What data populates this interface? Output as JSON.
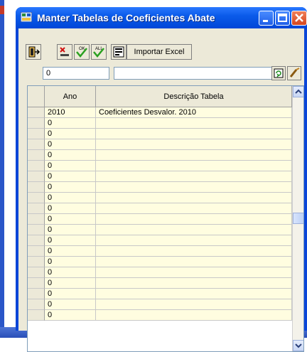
{
  "window": {
    "title": "Manter Tabelas de Coeficientes Abate"
  },
  "toolbar": {
    "import_excel_label": "Importar Excel"
  },
  "filters": {
    "code_value": "0",
    "description_value": ""
  },
  "grid": {
    "columns": [
      "Ano",
      "Descrição Tabela"
    ],
    "rows": [
      {
        "ano": "2010",
        "descricao": "Coeficientes Desvalor. 2010"
      },
      {
        "ano": "0",
        "descricao": ""
      },
      {
        "ano": "0",
        "descricao": ""
      },
      {
        "ano": "0",
        "descricao": ""
      },
      {
        "ano": "0",
        "descricao": ""
      },
      {
        "ano": "0",
        "descricao": ""
      },
      {
        "ano": "0",
        "descricao": ""
      },
      {
        "ano": "0",
        "descricao": ""
      },
      {
        "ano": "0",
        "descricao": ""
      },
      {
        "ano": "0",
        "descricao": ""
      },
      {
        "ano": "0",
        "descricao": ""
      },
      {
        "ano": "0",
        "descricao": ""
      },
      {
        "ano": "0",
        "descricao": ""
      },
      {
        "ano": "0",
        "descricao": ""
      },
      {
        "ano": "0",
        "descricao": ""
      },
      {
        "ano": "0",
        "descricao": ""
      },
      {
        "ano": "0",
        "descricao": ""
      },
      {
        "ano": "0",
        "descricao": ""
      },
      {
        "ano": "0",
        "descricao": ""
      },
      {
        "ano": "0",
        "descricao": ""
      }
    ]
  },
  "colors": {
    "titlebar": "#0046d8",
    "grid_row_bg": "#fffde0",
    "window_bg": "#ece9d8"
  },
  "icons": [
    "exit-icon",
    "delete-icon",
    "ok-icon",
    "ok-all-icon",
    "report-icon",
    "refresh-icon",
    "clear-icon",
    "window-app-icon"
  ]
}
